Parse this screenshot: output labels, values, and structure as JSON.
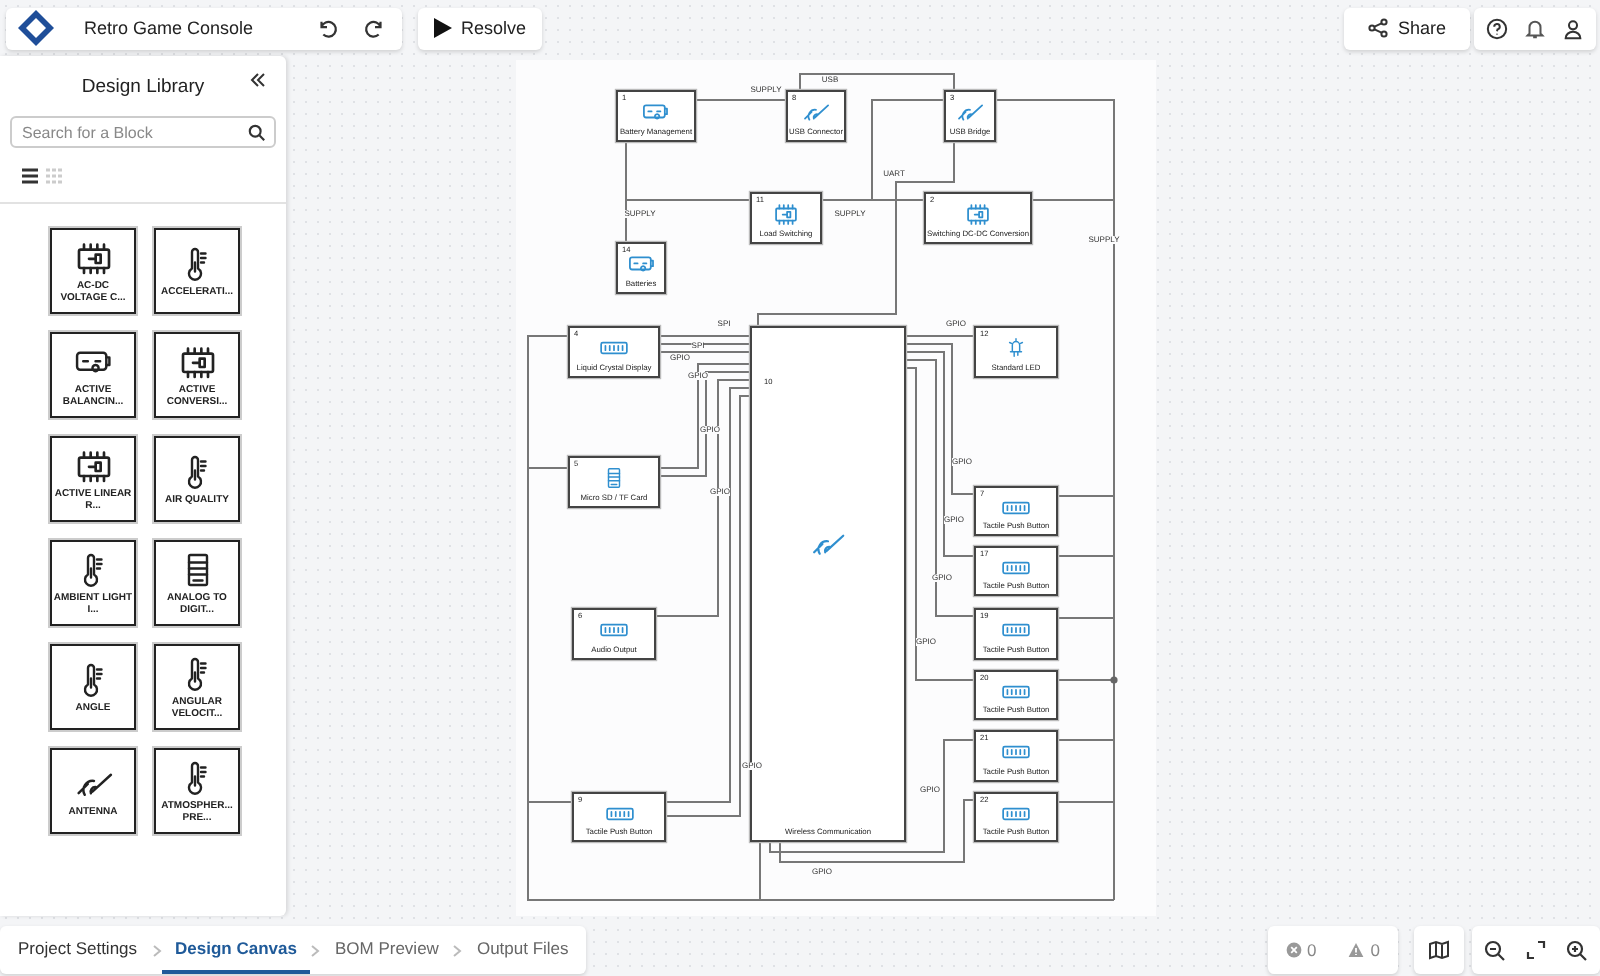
{
  "header": {
    "title": "Retro Game Console",
    "resolve_label": "Resolve",
    "share_label": "Share"
  },
  "library": {
    "title": "Design Library",
    "search": {
      "placeholder": "Search for a Block"
    },
    "views": [
      {
        "kind": "list",
        "selected": true
      },
      {
        "kind": "grid",
        "selected": false
      }
    ],
    "blocks": [
      {
        "label": "AC-DC VOLTAGE C...",
        "kind": "chip"
      },
      {
        "label": "ACCELERATI...",
        "kind": "sensor"
      },
      {
        "label": "ACTIVE BALANCIN...",
        "kind": "battery"
      },
      {
        "label": "ACTIVE CONVERSI...",
        "kind": "chip"
      },
      {
        "label": "ACTIVE LINEAR R...",
        "kind": "chip"
      },
      {
        "label": "AIR QUALITY",
        "kind": "sensor"
      },
      {
        "label": "AMBIENT LIGHT I...",
        "kind": "sensor"
      },
      {
        "label": "ANALOG TO DIGIT...",
        "kind": "memory"
      },
      {
        "label": "ANGLE",
        "kind": "sensor"
      },
      {
        "label": "ANGULAR VELOCIT...",
        "kind": "sensor"
      },
      {
        "label": "ANTENNA",
        "kind": "antenna"
      },
      {
        "label": "ATMOSPHER... PRE...",
        "kind": "sensor"
      }
    ]
  },
  "diagram": {
    "nodes": [
      {
        "number": "1",
        "name": "Battery Management",
        "kind": "battery"
      },
      {
        "number": "8",
        "name": "USB Connector",
        "kind": "antenna"
      },
      {
        "number": "3",
        "name": "USB Bridge",
        "kind": "antenna"
      },
      {
        "number": "11",
        "name": "Load Switching",
        "kind": "chip"
      },
      {
        "number": "2",
        "name": "Switching DC-DC Conversion",
        "kind": "chip"
      },
      {
        "number": "14",
        "name": "Batteries",
        "kind": "battery"
      },
      {
        "number": "4",
        "name": "Liquid Crystal Display",
        "kind": "display"
      },
      {
        "number": "10",
        "name": "Wireless Communication",
        "kind": "antenna"
      },
      {
        "number": "12",
        "name": "Standard LED",
        "kind": "led"
      },
      {
        "number": "5",
        "name": "Micro SD / TF Card",
        "kind": "memory"
      },
      {
        "number": "6",
        "name": "Audio Output",
        "kind": "display"
      },
      {
        "number": "9",
        "name": "Tactile Push Button",
        "kind": "display"
      },
      {
        "number": "7",
        "name": "Tactile Push Button",
        "kind": "display"
      },
      {
        "number": "17",
        "name": "Tactile Push Button",
        "kind": "display"
      },
      {
        "number": "19",
        "name": "Tactile Push Button",
        "kind": "display"
      },
      {
        "number": "20",
        "name": "Tactile Push Button",
        "kind": "display"
      },
      {
        "number": "21",
        "name": "Tactile Push Button",
        "kind": "display"
      },
      {
        "number": "22",
        "name": "Tactile Push Button",
        "kind": "display"
      }
    ],
    "connection_labels": [
      "SUPPLY",
      "USB",
      "UART",
      "SUPPLY",
      "SUPPLY",
      "SUPPLY",
      "SPI",
      "SPI",
      "GPIO",
      "GPIO",
      "GPIO",
      "GPIO",
      "GPIO",
      "GPIO",
      "GPIO",
      "GPIO",
      "GPIO",
      "GPIO",
      "GPIO",
      "GPIO"
    ]
  },
  "steps": [
    {
      "label": "Project Settings",
      "selected": false
    },
    {
      "label": "Design Canvas",
      "selected": true
    },
    {
      "label": "BOM Preview",
      "selected": false
    },
    {
      "label": "Output Files",
      "selected": false
    }
  ],
  "status": {
    "errors": "0",
    "warnings": "0"
  }
}
